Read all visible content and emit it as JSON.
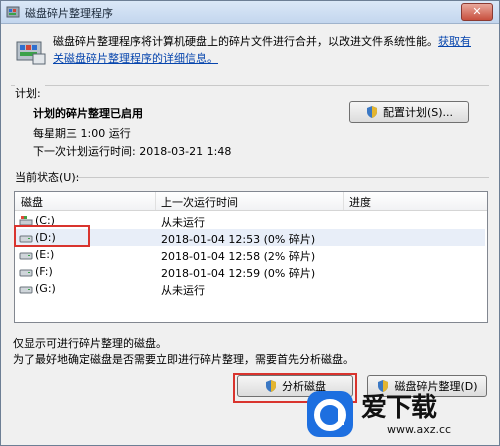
{
  "window": {
    "title": "磁盘碎片整理程序",
    "close_label": "✕"
  },
  "intro": {
    "text": "磁盘碎片整理程序将计算机硬盘上的碎片文件进行合并，以改进文件系统性能。",
    "link": "获取有关磁盘碎片整理程序的详细信息。"
  },
  "schedule": {
    "section_label": "计划:",
    "title": "计划的碎片整理已启用",
    "line1": "每星期三 1:00 运行",
    "line2": "下一次计划运行时间: 2018-03-21 1:48",
    "config_button": "配置计划(S)..."
  },
  "status": {
    "section_label": "当前状态(U):",
    "columns": [
      "磁盘",
      "上一次运行时间",
      "进度"
    ],
    "rows": [
      {
        "disk": "(C:)",
        "last_run": "从未运行",
        "progress": ""
      },
      {
        "disk": "(D:)",
        "last_run": "2018-01-04 12:53 (0% 碎片)",
        "progress": ""
      },
      {
        "disk": "(E:)",
        "last_run": "2018-01-04 12:58 (2% 碎片)",
        "progress": ""
      },
      {
        "disk": "(F:)",
        "last_run": "2018-01-04 12:59 (0% 碎片)",
        "progress": ""
      },
      {
        "disk": "(G:)",
        "last_run": "从未运行",
        "progress": ""
      }
    ]
  },
  "notes": {
    "line1": "仅显示可进行碎片整理的磁盘。",
    "line2": "为了最好地确定磁盘是否需要立即进行碎片整理，需要首先分析磁盘。"
  },
  "buttons": {
    "analyze": "分析磁盘",
    "defrag": "磁盘碎片整理(D)"
  },
  "watermark": {
    "text": "爱下载",
    "url": "www.axz.cc"
  },
  "colors": {
    "highlight": "#d9342e",
    "link": "#0645ad"
  }
}
